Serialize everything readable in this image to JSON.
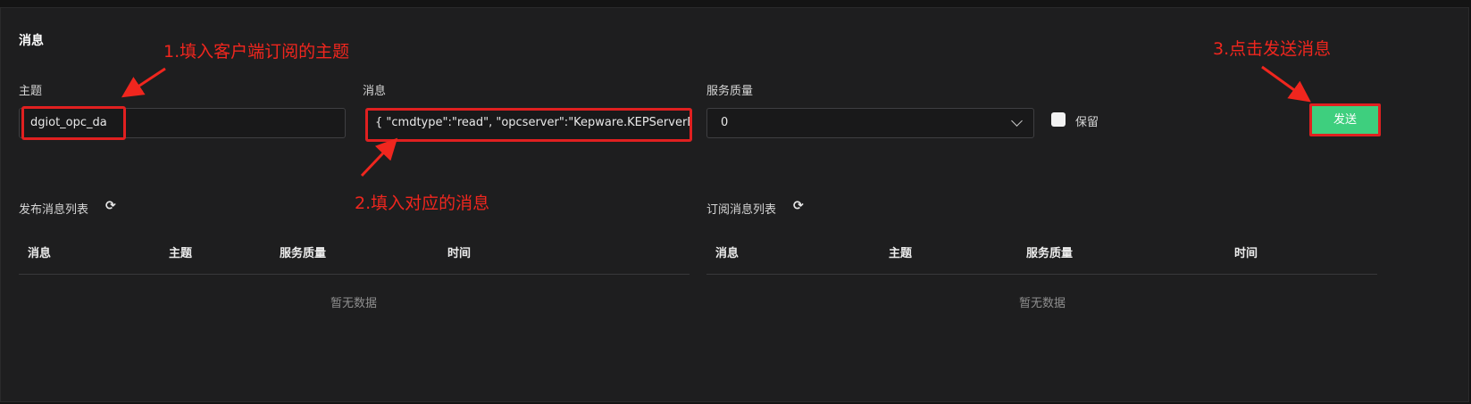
{
  "section_title": "消息",
  "annotations": {
    "step1": "1.填入客户端订阅的主题",
    "step2": "2.填入对应的消息",
    "step3": "3.点击发送消息"
  },
  "form": {
    "topic_label": "主题",
    "topic_value": "dgiot_opc_da",
    "message_label": "消息",
    "message_value": "{  \"cmdtype\":\"read\",  \"opcserver\":\"Kepware.KEPServerEX",
    "qos_label": "服务质量",
    "qos_value": "0",
    "retain_label": "保留",
    "send_label": "发送"
  },
  "publish_list": {
    "title": "发布消息列表",
    "columns": [
      "消息",
      "主题",
      "服务质量",
      "时间"
    ],
    "rows": [],
    "empty_text": "暂无数据"
  },
  "subscribe_list": {
    "title": "订阅消息列表",
    "columns": [
      "消息",
      "主题",
      "服务质量",
      "时间"
    ],
    "rows": [],
    "empty_text": "暂无数据"
  },
  "icons": {
    "refresh": "refresh-icon",
    "chevron": "chevron-down-icon",
    "arrow": "annotation-arrow-icon"
  },
  "colors": {
    "accent": "#3ecf7e",
    "annotation": "#f0261e",
    "panel": "#1e1e1f"
  }
}
